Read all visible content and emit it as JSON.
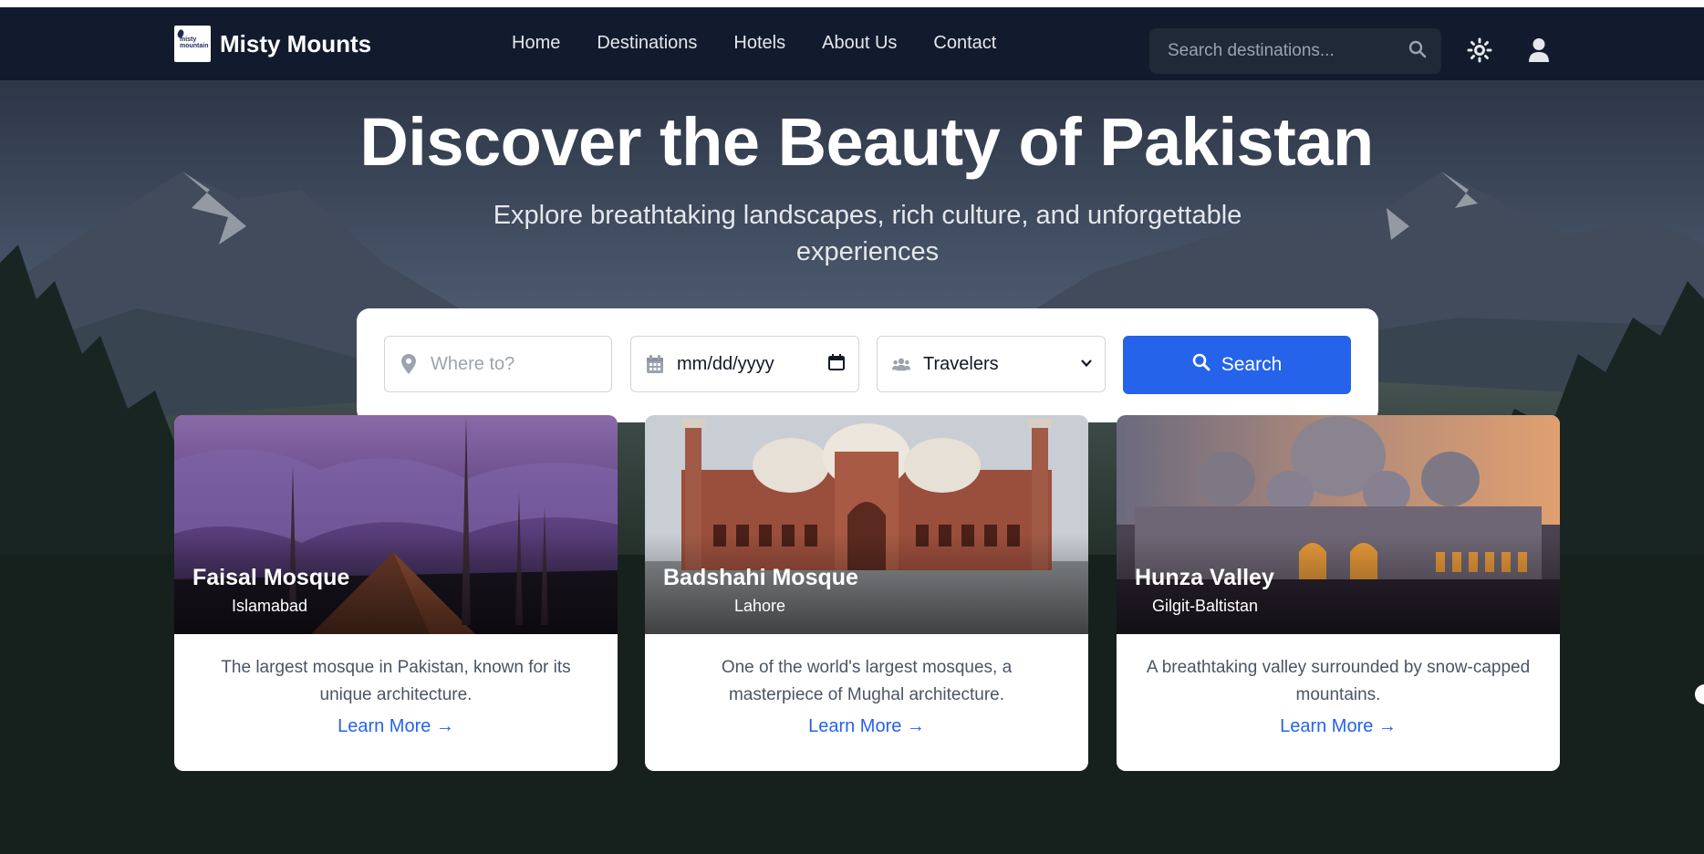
{
  "brand": {
    "name": "Misty Mounts",
    "logo_text_1": "misty",
    "logo_text_2": "mountain"
  },
  "nav": {
    "links": [
      "Home",
      "Destinations",
      "Hotels",
      "About Us",
      "Contact"
    ]
  },
  "header_search": {
    "placeholder": "Search destinations..."
  },
  "icons": {
    "theme": "sun-icon",
    "user": "user-icon",
    "search": "search-icon"
  },
  "hero": {
    "title": "Discover the Beauty of Pakistan",
    "subtitle": "Explore breathtaking landscapes, rich culture, and unforgettable experiences"
  },
  "search_form": {
    "where_placeholder": "Where to?",
    "date_value": "mm/dd/yyyy",
    "travelers_value": "Travelers",
    "button_label": "Search"
  },
  "cards": [
    {
      "name": "Faisal Mosque",
      "location": "Islamabad",
      "description": "The largest mosque in Pakistan, known for its unique architecture.",
      "link": "Learn More →"
    },
    {
      "name": "Badshahi Mosque",
      "location": "Lahore",
      "description": "One of the world's largest mosques, a masterpiece of Mughal architecture.",
      "link": "Learn More →"
    },
    {
      "name": "Hunza Valley",
      "location": "Gilgit-Baltistan",
      "description": "A breathtaking valley surrounded by snow-capped mountains.",
      "link": "Learn More →"
    }
  ],
  "colors": {
    "navbar": "#121b2d",
    "accent": "#2563eb",
    "search_bg": "#1f2937"
  }
}
